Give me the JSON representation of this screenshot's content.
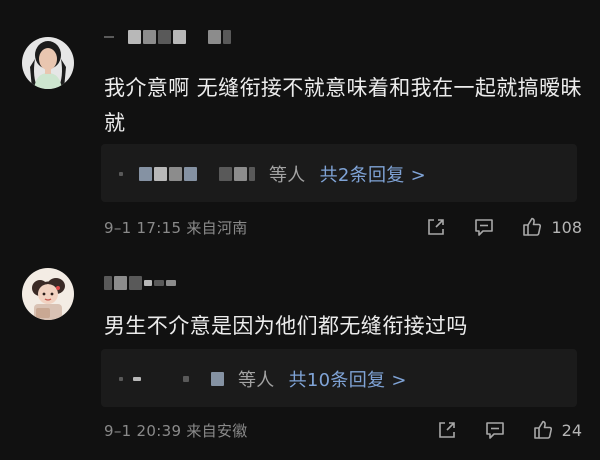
{
  "comments": [
    {
      "text": "我介意啊 无缝衔接不就意味着和我在一起就搞暧昧就",
      "replies": {
        "label": "等人",
        "count_label": "共2条回复 >"
      },
      "meta": "9–1 17:15  来自河南",
      "likes": "108",
      "avatar_icon": "woman-portrait-avatar"
    },
    {
      "text": "男生不介意是因为他们都无缝衔接过吗",
      "replies": {
        "label": "等人",
        "count_label": "共10条回复 >"
      },
      "meta": "9–1 20:39  来自安徽",
      "likes": "24",
      "avatar_icon": "cartoon-girl-avatar"
    }
  ],
  "colors": {
    "background": "#111111",
    "reply_box": "#1b1b1b",
    "text": "#ececec",
    "meta": "#8a8a8a",
    "link": "#7fa3d6"
  },
  "icons": {
    "share": "share-icon",
    "comment": "comment-icon",
    "like": "thumbs-up-icon"
  }
}
